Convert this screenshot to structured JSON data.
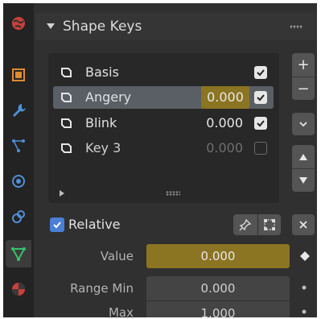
{
  "tabs": [
    {
      "name": "world",
      "icon": "world-icon"
    },
    {
      "name": "object",
      "icon": "object-icon"
    },
    {
      "name": "modifiers",
      "icon": "wrench-icon"
    },
    {
      "name": "particles",
      "icon": "particles-icon"
    },
    {
      "name": "physics",
      "icon": "physics-icon"
    },
    {
      "name": "constraints",
      "icon": "constraints-icon"
    },
    {
      "name": "data",
      "icon": "mesh-data-icon",
      "active": true
    },
    {
      "name": "material",
      "icon": "material-icon"
    }
  ],
  "panel": {
    "title": "Shape Keys"
  },
  "shape_keys": [
    {
      "label": "Basis",
      "value": "",
      "checked": true
    },
    {
      "label": "Angery",
      "value": "0.000",
      "checked": true,
      "selected": true
    },
    {
      "label": "Blink",
      "value": "0.000",
      "checked": true
    },
    {
      "label": "Key 3",
      "value": "0.000",
      "checked": false
    }
  ],
  "side_buttons": {
    "add": "+",
    "remove": "−"
  },
  "relative": {
    "label": "Relative",
    "checked": true
  },
  "properties": {
    "value_label": "Value",
    "value": "0.000",
    "range_min_label": "Range Min",
    "range_min": "0.000",
    "max_label": "Max",
    "max": "1.000"
  },
  "colors": {
    "accent_blue": "#4a7fd6",
    "animated_field": "#8b7422",
    "selected_row": "#5a5f66"
  }
}
